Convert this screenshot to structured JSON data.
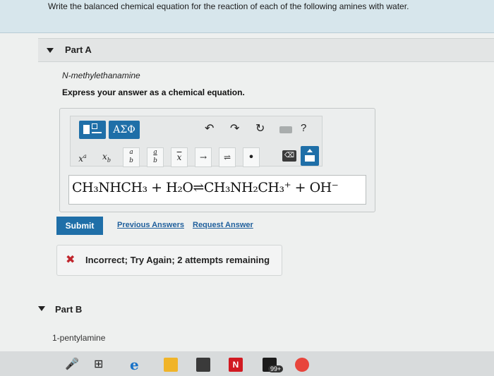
{
  "instructions": "Write the balanced chemical equation for the reaction of each of the following amines with water.",
  "part_a": {
    "title": "Part A",
    "compound": "N-methylethanamine",
    "prompt": "Express your answer as a chemical equation.",
    "toolbar": {
      "greek_label": "ΑΣΦ",
      "help_label": "?",
      "symbols": [
        "x",
        "x",
        "a/b",
        "a/b",
        "x̄",
        "→",
        "⇌",
        "•"
      ]
    },
    "answer": "CH₃NHCH₃ + H₂O⇌CH₃NH₂CH₃⁺ + OH⁻",
    "submit_label": "Submit",
    "previous_answers_label": "Previous Answers",
    "request_answer_label": "Request Answer",
    "feedback": "Incorrect; Try Again; 2 attempts remaining"
  },
  "part_b": {
    "title": "Part B",
    "compound": "1-pentylamine"
  },
  "taskbar": {
    "badge": "99+"
  },
  "colors": {
    "accent": "#1f6fa8",
    "error": "#c0262d"
  }
}
